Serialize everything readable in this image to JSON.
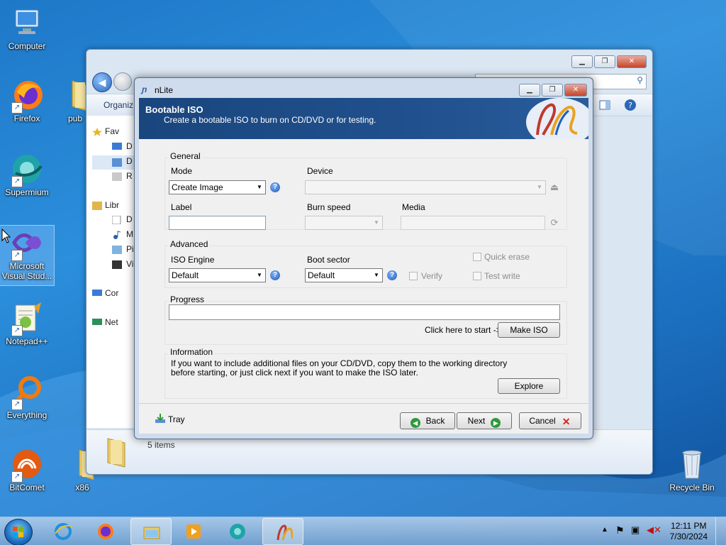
{
  "desktop": {
    "icons": [
      {
        "label": "Computer"
      },
      {
        "label": "Firefox"
      },
      {
        "label": "pub"
      },
      {
        "label": "Supermium"
      },
      {
        "label": "Microsoft Visual Stud..."
      },
      {
        "label": "Notepad++"
      },
      {
        "label": "Everything"
      },
      {
        "label": "BitComet"
      },
      {
        "label": "x86"
      },
      {
        "label": "Recycle Bin"
      }
    ]
  },
  "explorer": {
    "toolbar_label": "Organiz",
    "nav_items": [
      "Fav",
      "D",
      "D",
      "R",
      "Libr",
      "D",
      "M",
      "Pi",
      "Vi",
      "Cor",
      "Net"
    ],
    "status_count": "5 items"
  },
  "nlite": {
    "title": "nLite",
    "banner": {
      "title": "Bootable ISO",
      "subtitle": "Create a bootable ISO to burn on CD/DVD or for testing."
    },
    "general": {
      "group_title": "General",
      "mode_label": "Mode",
      "mode_value": "Create Image",
      "device_label": "Device",
      "device_value": "",
      "label_label": "Label",
      "label_value": "",
      "burn_speed_label": "Burn speed",
      "burn_speed_value": "",
      "media_label": "Media",
      "media_value": ""
    },
    "advanced": {
      "group_title": "Advanced",
      "iso_engine_label": "ISO Engine",
      "iso_engine_value": "Default",
      "boot_sector_label": "Boot sector",
      "boot_sector_value": "Default",
      "verify_label": "Verify",
      "quick_erase_label": "Quick erase",
      "test_write_label": "Test write"
    },
    "progress": {
      "group_title": "Progress",
      "value": 0,
      "hint": "Click here to start ->",
      "make_iso_label": "Make ISO"
    },
    "information": {
      "group_title": "Information",
      "line1": "If you want to include additional files on your CD/DVD, copy them to the working directory",
      "line2": "before starting, or just click next if you want to make the ISO later.",
      "explore_label": "Explore"
    },
    "footer": {
      "tray_label": "Tray",
      "back_label": "Back",
      "next_label": "Next",
      "cancel_label": "Cancel"
    }
  },
  "taskbar": {
    "clock_time": "12:11 PM",
    "clock_date": "7/30/2024"
  },
  "colors": {
    "banner": "#1a467e",
    "accent_green": "#33b34a",
    "close_red": "#c5452d"
  }
}
